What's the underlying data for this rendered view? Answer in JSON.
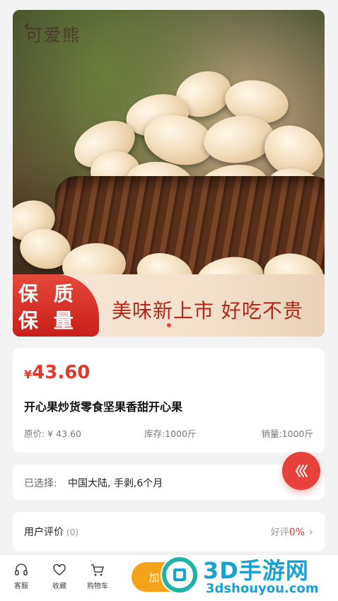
{
  "hero": {
    "brand": "可爱熊",
    "badge_line1": "保 质",
    "badge_line2": "保 量",
    "slogan": "美味新上市 好吃不贵"
  },
  "product": {
    "currency": "¥",
    "price": "43.60",
    "title": "开心果炒货零食坚果香甜开心果",
    "original_price": "原价: ¥ 43.60",
    "stock": "库存:1000斤",
    "sales": "销量:1000斤"
  },
  "selection": {
    "label": "已选择:",
    "value": "中国大陆, 手剥,6个月"
  },
  "reviews": {
    "title": "用户评价",
    "count": "(0)",
    "positive_label": "好评",
    "positive_rate": "0%"
  },
  "bottom_bar": {
    "service": "客服",
    "favorite": "收藏",
    "cart": "购物车",
    "add_to_cart": "加"
  },
  "watermark": {
    "title": "3D手游网",
    "url": "3dshouyou.com"
  },
  "colors": {
    "price_red": "#e2382b",
    "add_cart_orange": "#f6a21a",
    "float_button": "#e8403a"
  }
}
